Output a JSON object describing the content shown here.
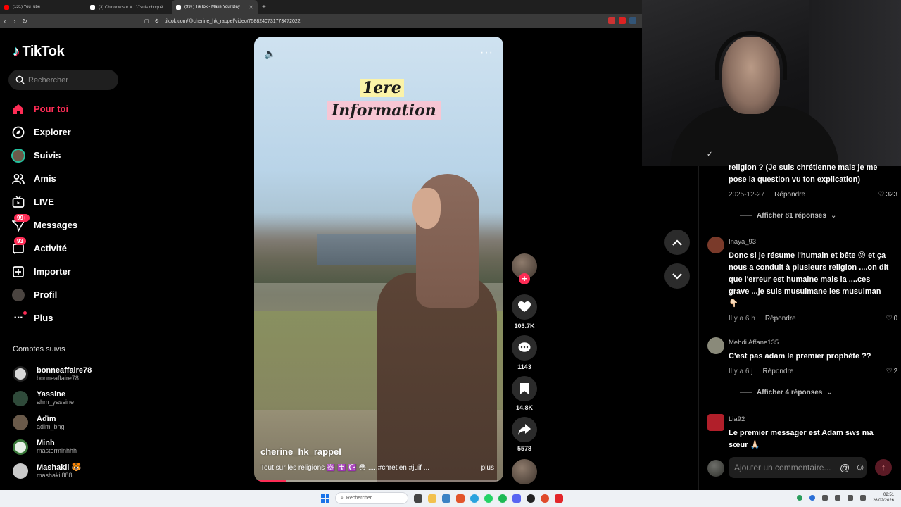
{
  "browser": {
    "tabs": [
      {
        "label": "(131) YouTube",
        "color": "#ff0000",
        "active": false
      },
      {
        "label": "(3) Chinoow sur X : \"J'suis choqué 🤬",
        "color": "#ffffff",
        "active": false
      },
      {
        "label": "(99+) TikTok - Make Your Day",
        "color": "#ffffff",
        "active": true
      }
    ],
    "url": "tiktok.com/@cherine_hk_rappel/video/7588240731773472022",
    "new_tab": "+"
  },
  "sidebar": {
    "brand": "TikTok",
    "search_placeholder": "Rechercher",
    "nav": [
      {
        "label": "Pour toi",
        "icon": "home-icon",
        "active": true
      },
      {
        "label": "Explorer",
        "icon": "compass-icon"
      },
      {
        "label": "Suivis",
        "icon": "following-avatar-icon"
      },
      {
        "label": "Amis",
        "icon": "friends-icon"
      },
      {
        "label": "LIVE",
        "icon": "live-tv-icon"
      },
      {
        "label": "Messages",
        "icon": "message-send-icon",
        "badge": "99+"
      },
      {
        "label": "Activité",
        "icon": "activity-inbox-icon",
        "badge": "93"
      },
      {
        "label": "Importer",
        "icon": "upload-plus-icon"
      },
      {
        "label": "Profil",
        "icon": "profile-avatar-icon"
      },
      {
        "label": "Plus",
        "icon": "more-dots-icon",
        "dot": true
      }
    ],
    "following_title": "Comptes suivis",
    "following": [
      {
        "name": "bonneaffaire78",
        "handle": "bonneaffaire78",
        "color": "#d8d8d8"
      },
      {
        "name": "Yassine",
        "handle": "ahm_yassine",
        "color": "#2f4a3a"
      },
      {
        "name": "Adïm",
        "handle": "adim_bng",
        "color": "#6a5a4a"
      },
      {
        "name": "Minh",
        "handle": "masterminhhh",
        "color": "#e6f0e6"
      },
      {
        "name": "Mashakil 🐯",
        "handle": "mashakil888",
        "color": "#c9c9c9"
      }
    ]
  },
  "video": {
    "overlay_line1": "1ere",
    "overlay_line2": "Information",
    "author": "cherine_hk_rappel",
    "description": "Tout sur les religions ☸️ ☦️ ☪️ 😳 .....#chretien #juif ...",
    "more_label": "plus",
    "progress": 0.13
  },
  "actions": {
    "follow_plus": "+",
    "likes": "103.7K",
    "comments": "1143",
    "saves": "14.8K",
    "shares": "5578"
  },
  "comments": {
    "items": [
      {
        "partial": true,
        "text": "religion ? (Je suis chrétienne mais je me pose la question vu ton explication)",
        "date": "2025-12-27",
        "reply": "Répondre",
        "likes": "323",
        "replies": "Afficher 81 réponses"
      },
      {
        "user": "Inaya_93",
        "text": "Donc si je résume l'humain et bête 😜 et ça nous a conduit à plusieurs religion ....on dit que l'erreur est humaine mais la ....ces grave ...je suis musulmane les musulman 👇🏻",
        "date": "Il y a 6 h",
        "reply": "Répondre",
        "likes": "0",
        "avatar_color": "#7a3a2a"
      },
      {
        "user": "Mehdi Affane135",
        "text": "C'est pas adam le premier prophète ??",
        "date": "Il y a 6 j",
        "reply": "Répondre",
        "likes": "2",
        "replies": "Afficher 4 réponses",
        "avatar_color": "#8a8a7a"
      },
      {
        "user": "Lia92",
        "text": "Le premier messager est Adam sws ma sœur 🙏🏻",
        "avatar_color": "#b11f2a"
      }
    ],
    "input_placeholder": "Ajouter un commentaire..."
  },
  "taskbar": {
    "search_label": "Rechercher",
    "time": "02:51",
    "date": "26/02/2026"
  }
}
